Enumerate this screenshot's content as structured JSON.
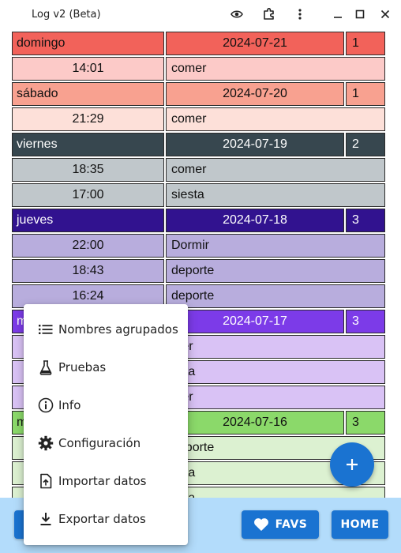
{
  "window": {
    "title": "Log v2 (Beta)"
  },
  "titlebar_icons": [
    "eye-icon",
    "extension-icon",
    "more-vert-icon",
    "minimize-icon",
    "maximize-icon",
    "close-icon"
  ],
  "log": {
    "days": [
      {
        "day": "domingo",
        "date": "2024-07-21",
        "count": "1",
        "header_color": "#f2625a",
        "entry_color": "#fccac8",
        "entries": [
          {
            "time": "14:01",
            "activity": "comer"
          }
        ]
      },
      {
        "day": "sábado",
        "date": "2024-07-20",
        "count": "1",
        "header_color": "#f8a190",
        "entry_color": "#fde0d9",
        "entries": [
          {
            "time": "21:29",
            "activity": "comer"
          }
        ]
      },
      {
        "day": "viernes",
        "date": "2024-07-19",
        "count": "2",
        "header_color": "#37474f",
        "entry_color": "#c0c7cb",
        "entries": [
          {
            "time": "18:35",
            "activity": "comer"
          },
          {
            "time": "17:00",
            "activity": "siesta"
          }
        ]
      },
      {
        "day": "jueves",
        "date": "2024-07-18",
        "count": "3",
        "header_color": "#31128f",
        "entry_color": "#b8addd",
        "entries": [
          {
            "time": "22:00",
            "activity": "Dormir"
          },
          {
            "time": "18:43",
            "activity": "deporte"
          },
          {
            "time": "16:24",
            "activity": "deporte"
          }
        ]
      },
      {
        "day": "m",
        "date": "2024-07-17",
        "count": "3",
        "header_color": "#7c3be8",
        "entry_color": "#d9c2f5",
        "entries": [
          {
            "time": "",
            "activity": "mer"
          },
          {
            "time": "",
            "activity": "esta"
          },
          {
            "time": "",
            "activity": "mer"
          }
        ]
      },
      {
        "day": "m",
        "date": "2024-07-16",
        "count": "3",
        "header_color": "#8bd96a",
        "entry_color": "#dcf1d1",
        "entries": [
          {
            "time": "",
            "activity": "deporte"
          },
          {
            "time": "",
            "activity": "esta"
          },
          {
            "time": "",
            "activity": "esta"
          }
        ]
      }
    ]
  },
  "menu": {
    "items": [
      {
        "label": "Nombres agrupados",
        "icon": "list-icon"
      },
      {
        "label": "Pruebas",
        "icon": "flask-icon"
      },
      {
        "label": "Info",
        "icon": "info-icon"
      },
      {
        "label": "Configuración",
        "icon": "settings-icon"
      },
      {
        "label": "Importar datos",
        "icon": "file-upload-icon"
      },
      {
        "label": "Exportar datos",
        "icon": "download-icon"
      }
    ]
  },
  "bottom": {
    "favs_label": "FAVS",
    "home_label": "HOME"
  },
  "fab": {
    "icon": "plus-icon"
  },
  "colors": {
    "primary": "#1a73d1",
    "bottom_bar": "#b3dcfb"
  }
}
